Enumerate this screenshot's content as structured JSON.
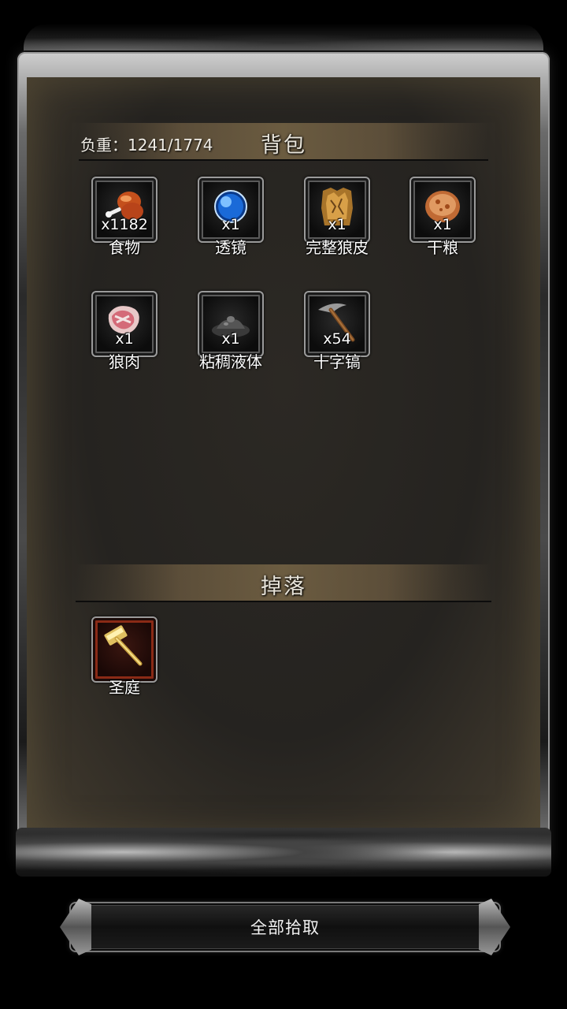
{
  "backpack": {
    "title": "背包",
    "weight": "负重：1241/1774",
    "items": [
      {
        "name": "食物",
        "count": "x1182",
        "icon": "roast-meat-icon"
      },
      {
        "name": "透镜",
        "count": "x1",
        "icon": "blue-orb-icon"
      },
      {
        "name": "完整狼皮",
        "count": "x1",
        "icon": "wolf-pelt-icon"
      },
      {
        "name": "干粮",
        "count": "x1",
        "icon": "dry-bread-icon"
      },
      {
        "name": "狼肉",
        "count": "x1",
        "icon": "raw-meat-icon"
      },
      {
        "name": "粘稠液体",
        "count": "x1",
        "icon": "sticky-liquid-icon"
      },
      {
        "name": "十字镐",
        "count": "x54",
        "icon": "pickaxe-icon"
      }
    ]
  },
  "drops": {
    "title": "掉落",
    "items": [
      {
        "name": "圣庭",
        "icon": "golden-hammer-icon"
      }
    ]
  },
  "pickup_all_label": "全部拾取"
}
